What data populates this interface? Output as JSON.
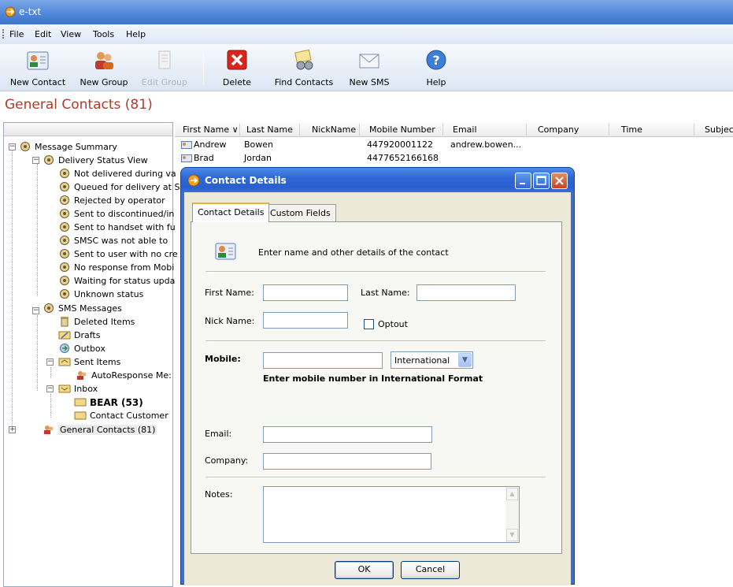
{
  "window": {
    "title": "e-txt"
  },
  "menu": [
    "File",
    "Edit",
    "View",
    "Tools",
    "Help"
  ],
  "toolbar": {
    "buttons": [
      {
        "label": "New Contact",
        "icon": "contact-card-icon",
        "enabled": true
      },
      {
        "label": "New Group",
        "icon": "group-people-icon",
        "enabled": true
      },
      {
        "label": "Edit Group",
        "icon": "edit-document-icon",
        "enabled": false
      },
      {
        "label": "Delete",
        "icon": "red-x-icon",
        "enabled": true
      },
      {
        "label": "Find Contacts",
        "icon": "binoculars-icon",
        "enabled": true
      },
      {
        "label": "New SMS",
        "icon": "envelope-icon",
        "enabled": true
      },
      {
        "label": "Help",
        "icon": "question-icon",
        "enabled": true
      }
    ]
  },
  "section_title": "General Contacts (81)",
  "tree": {
    "message_summary": "Message Summary",
    "delivery_status_view": "Delivery Status View",
    "status_items": [
      "Not delivered during va",
      "Queued for delivery at S",
      "Rejected by operator",
      "Sent to discontinued/in",
      "Sent to handset with fu",
      "SMSC was not able to",
      "Sent to user with no cre",
      "No response from Mobi",
      "Waiting for status upda",
      "Unknown status"
    ],
    "sms_messages": "SMS Messages",
    "deleted_items": "Deleted Items",
    "drafts": "Drafts",
    "outbox": "Outbox",
    "sent_items": "Sent Items",
    "autoresponse": "AutoResponse Me:",
    "inbox": "Inbox",
    "bear": "BEAR (53)",
    "contact_customer": "Contact Customer",
    "general_contacts": "General Contacts (81)"
  },
  "grid": {
    "columns": [
      "First Name ∨",
      "Last Name",
      "NickName",
      "Mobile Number",
      "Email",
      "Company",
      "Time",
      "Subjec"
    ],
    "rows": [
      {
        "first": "Andrew",
        "last": "Bowen",
        "nick": "",
        "mobile": "447920001122",
        "email": "andrew.bowen..."
      },
      {
        "first": "Brad",
        "last": "Jordan",
        "nick": "",
        "mobile": "4477652166168",
        "email": ""
      }
    ]
  },
  "dialog": {
    "title": "Contact Details",
    "tabs": [
      "Contact Details",
      "Custom Fields"
    ],
    "intro": "Enter name and other details of the contact",
    "first_name_label": "First Name:",
    "first_name_value": "",
    "last_name_label": "Last Name:",
    "last_name_value": "",
    "nick_name_label": "Nick Name:",
    "nick_name_value": "",
    "optout_label": "Optout",
    "optout_checked": false,
    "mobile_label": "Mobile:",
    "mobile_value": "",
    "mobile_format_selected": "International",
    "mobile_hint": "Enter mobile number in International Format",
    "email_label": "Email:",
    "email_value": "",
    "company_label": "Company:",
    "company_value": "",
    "notes_label": "Notes:",
    "notes_value": "",
    "ok_label": "OK",
    "cancel_label": "Cancel"
  }
}
